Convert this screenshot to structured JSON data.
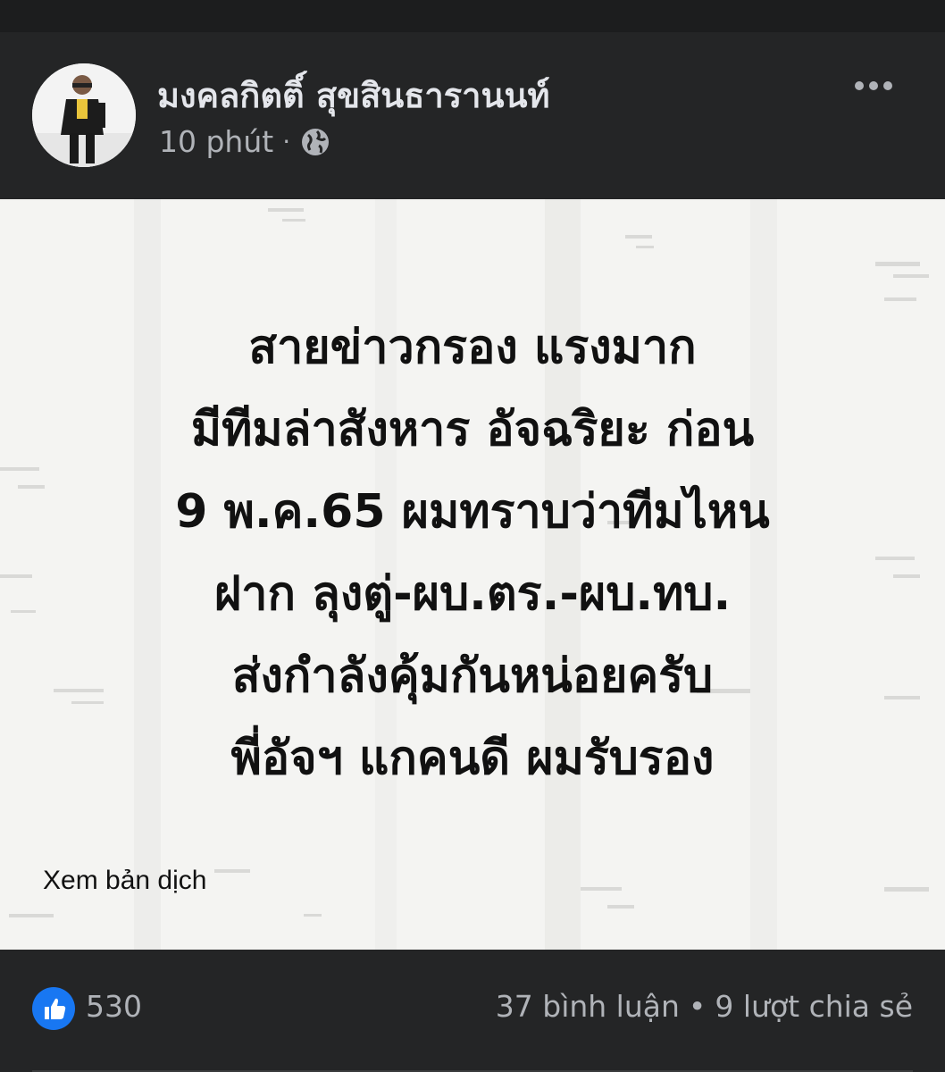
{
  "post": {
    "author_name": "มงคลกิตติ์ สุขสินธารานนท์",
    "timestamp": "10 phút",
    "separator": "·",
    "privacy_icon": "globe-icon",
    "more_icon": "more-options-icon",
    "image_text_lines": [
      "สายข่าวกรอง แรงมาก",
      "มีทีมล่าสังหาร  อัจฉริยะ ก่อน",
      "9 พ.ค.65 ผมทราบว่าทีมไหน",
      "ฝาก ลุงตู่-ผบ.ตร.-ผบ.ทบ.",
      "ส่งกำลังคุ้มกันหน่อยครับ",
      "พี่อัจฯ แกคนดี ผมรับรอง"
    ],
    "translate_label": "Xem bản dịch"
  },
  "reactions": {
    "like_icon": "like-thumb-icon",
    "like_count": "530",
    "comments": "37 bình luận",
    "dot": "•",
    "shares": "9 lượt chia sẻ"
  },
  "colors": {
    "background": "#242526",
    "text_primary": "#e4e6eb",
    "text_secondary": "#b0b3b8",
    "like_blue": "#1877f2"
  }
}
